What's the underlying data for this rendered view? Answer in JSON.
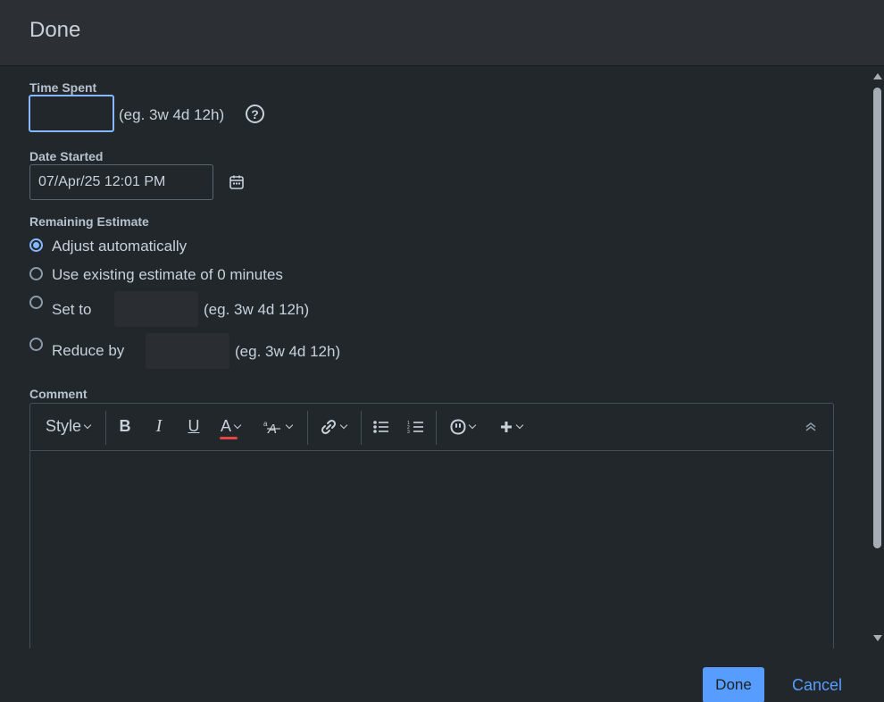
{
  "dialog": {
    "title": "Done"
  },
  "time_spent": {
    "label": "Time Spent",
    "value": "",
    "hint": "(eg. 3w 4d 12h)"
  },
  "date_started": {
    "label": "Date Started",
    "value": "07/Apr/25 12:01 PM"
  },
  "remaining_estimate": {
    "label": "Remaining Estimate",
    "options": [
      {
        "label": "Adjust automatically",
        "checked": true
      },
      {
        "label": "Use existing estimate of 0 minutes",
        "checked": false
      },
      {
        "label": "Set to",
        "checked": false,
        "hint": "(eg. 3w 4d 12h)"
      },
      {
        "label": "Reduce by",
        "checked": false,
        "hint": "(eg. 3w 4d 12h)"
      }
    ]
  },
  "comment": {
    "label": "Comment",
    "toolbar": {
      "style_label": "Style",
      "bold": "B",
      "italic": "I",
      "underline": "U",
      "text_color": "A"
    },
    "text_color_accent": "#e2483d"
  },
  "footer": {
    "done_label": "Done",
    "cancel_label": "Cancel"
  },
  "colors": {
    "primary": "#579dff",
    "focus": "#85b8ff"
  }
}
